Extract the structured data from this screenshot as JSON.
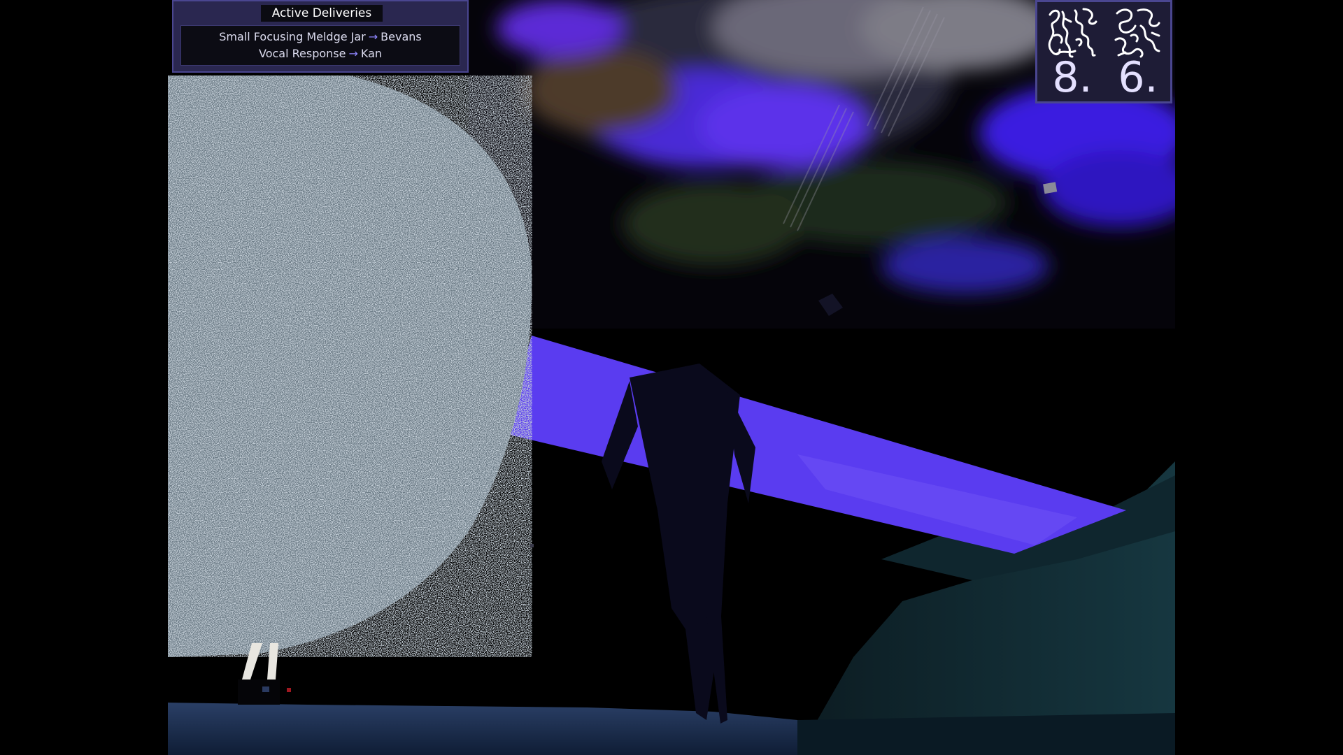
{
  "hud": {
    "deliveries": {
      "title": "Active Deliveries",
      "items": [
        {
          "item": "Small Focusing Meldge Jar",
          "arrow": "→",
          "recipient": "Bevans"
        },
        {
          "item": "Vocal Response",
          "arrow": "→",
          "recipient": "Kan"
        }
      ]
    },
    "runes": [
      {
        "icon": "scribble-rune-icon",
        "value": "8."
      },
      {
        "icon": "scribble-rune-icon",
        "value": "6."
      }
    ]
  },
  "colors": {
    "accent": "#5a3cf0",
    "panel": "#2a2750",
    "panel_border": "#4a4690",
    "arrow": "#8f86ff"
  }
}
